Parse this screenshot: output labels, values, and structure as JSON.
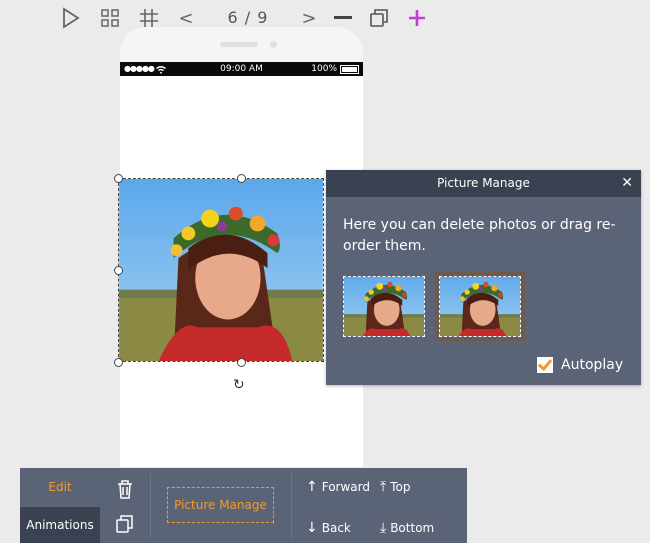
{
  "toolbar": {
    "page_indicator": "6 / 9",
    "prev_label": "<",
    "next_label": ">",
    "icons": [
      "play-icon",
      "grid-icon",
      "hash-grid-icon",
      "minus-icon",
      "duplicate-icon",
      "plus-icon"
    ]
  },
  "phone": {
    "status_time": "09:00 AM",
    "status_battery": "100%",
    "status_signal": "●●●●●"
  },
  "popup": {
    "title": "Picture Manage",
    "close_label": "✕",
    "description": "Here you can delete photos or drag re-order them.",
    "autoplay_label": "Autoplay",
    "autoplay_checked": true,
    "thumb_count": 2
  },
  "bottom_bar": {
    "edit_label": "Edit",
    "animations_label": "Animations",
    "picture_manage_label": "Picture Manage",
    "forward_label": "Forward",
    "top_label": "Top",
    "back_label": "Back",
    "bottom_label": "Bottom"
  },
  "colors": {
    "accent": "#f29a2e",
    "panel": "#5b6476",
    "panel_dark": "#3a4150",
    "plus": "#c43cd8"
  }
}
